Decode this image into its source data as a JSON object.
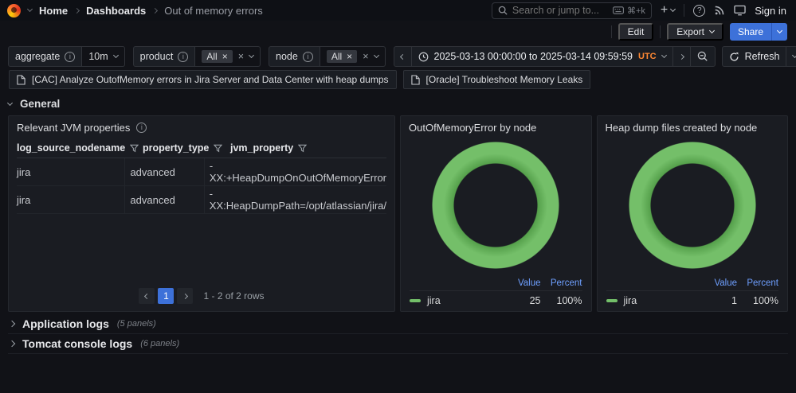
{
  "nav": {
    "breadcrumb": [
      {
        "label": "Home"
      },
      {
        "label": "Dashboards"
      },
      {
        "label": "Out of memory errors"
      }
    ],
    "search": {
      "placeholder": "Search or jump to...",
      "shortcut": "⌘+k"
    },
    "sign_in_label": "Sign in"
  },
  "toolbar": {
    "edit_label": "Edit",
    "export_label": "Export",
    "share_label": "Share"
  },
  "filters": {
    "aggregate": {
      "label": "aggregate",
      "value": "10m"
    },
    "product": {
      "label": "product",
      "selected": "All"
    },
    "node": {
      "label": "node",
      "selected": "All"
    }
  },
  "timebar": {
    "range": "2025-03-13 00:00:00 to 2025-03-14 09:59:59",
    "timezone": "UTC",
    "refresh_label": "Refresh"
  },
  "links": [
    {
      "label": "[CAC] Analyze OutofMemory errors in Jira Server and Data Center with heap dumps"
    },
    {
      "label": "[Oracle] Troubleshoot Memory Leaks"
    }
  ],
  "sections": {
    "general_title": "General",
    "collapsed_rows": [
      {
        "title": "Application logs",
        "panel_count": "(5 panels)"
      },
      {
        "title": "Tomcat console logs",
        "panel_count": "(6 panels)"
      }
    ]
  },
  "table_panel": {
    "title": "Relevant JVM properties",
    "columns": [
      "log_source_nodename",
      "property_type",
      "jvm_property"
    ],
    "rows": [
      [
        "jira",
        "advanced",
        "-XX:+HeapDumpOnOutOfMemoryError"
      ],
      [
        "jira",
        "advanced",
        "-XX:HeapDumpPath=/opt/atlassian/jira/"
      ]
    ],
    "pagination": {
      "current_page": "1",
      "info": "1 - 2 of 2 rows"
    }
  },
  "chart_data": [
    {
      "type": "pie",
      "donut": true,
      "title": "OutOfMemoryError by node",
      "legend_position": "bottom",
      "legend_headers": [
        "Value",
        "Percent"
      ],
      "series": [
        {
          "name": "jira",
          "value": 25,
          "percent": "100%",
          "color": "#73BF69"
        }
      ]
    },
    {
      "type": "pie",
      "donut": true,
      "title": "Heap dump files created by node",
      "legend_position": "bottom",
      "legend_headers": [
        "Value",
        "Percent"
      ],
      "series": [
        {
          "name": "jira",
          "value": 1,
          "percent": "100%",
          "color": "#73BF69"
        }
      ]
    }
  ],
  "icons": {
    "info": "i",
    "question": "?",
    "close": "×",
    "plus": "+"
  },
  "colors": {
    "accent_blue": "#3D71D9",
    "legend_link_blue": "#6E9FFF",
    "series_green": "#73BF69",
    "timezone_orange": "#FF8833",
    "panel_bg": "#1A1C22",
    "page_bg": "#111217"
  }
}
